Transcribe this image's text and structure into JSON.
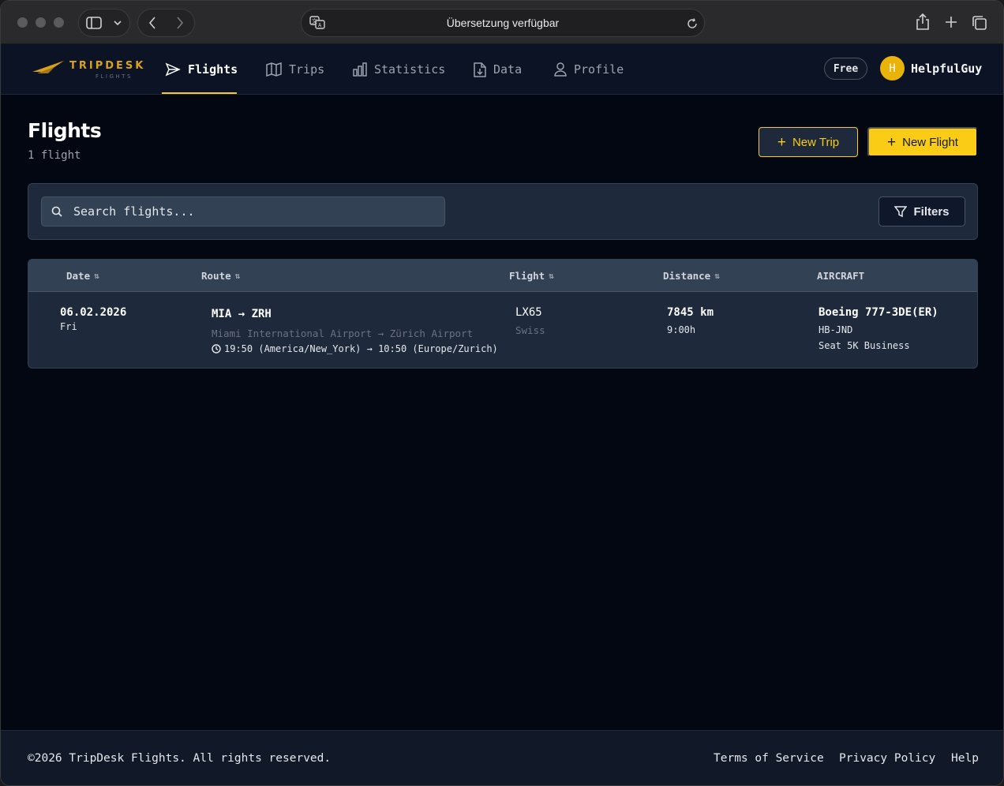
{
  "browser": {
    "address_text": "Übersetzung verfügbar"
  },
  "brand": {
    "name": "TRIPDESK",
    "sub": "FLIGHTS",
    "accent": "#facc15"
  },
  "nav": {
    "items": [
      {
        "label": "Flights",
        "icon": "send-icon",
        "active": true
      },
      {
        "label": "Trips",
        "icon": "map-icon",
        "active": false
      },
      {
        "label": "Statistics",
        "icon": "bar-chart-icon",
        "active": false
      },
      {
        "label": "Data",
        "icon": "file-import-icon",
        "active": false
      },
      {
        "label": "Profile",
        "icon": "user-icon",
        "active": false
      }
    ],
    "plan_badge": "Free",
    "avatar_initial": "H",
    "username": "HelpfulGuy"
  },
  "page": {
    "title": "Flights",
    "count": "1 flight",
    "new_trip_label": "New Trip",
    "new_flight_label": "New Flight"
  },
  "search": {
    "placeholder": "Search flights...",
    "filters_label": "Filters"
  },
  "table": {
    "columns": {
      "date": "Date",
      "route": "Route",
      "flight": "Flight",
      "distance": "Distance",
      "aircraft": "AIRCRAFT"
    },
    "rows": [
      {
        "date": "06.02.2026",
        "weekday": "Fri",
        "route": "MIA → ZRH",
        "airports": "Miami International Airport → Zürich Airport",
        "times": "19:50 (America/New_York) → 10:50 (Europe/Zurich)",
        "flight_no": "LX65",
        "airline": "Swiss",
        "distance": "7845 km",
        "duration": "9:00h",
        "aircraft": "Boeing 777-3DE(ER)",
        "registration": "HB-JND",
        "seat": "Seat 5K Business"
      }
    ]
  },
  "footer": {
    "copyright": "©2026 TripDesk Flights. All rights reserved.",
    "links": [
      "Terms of Service",
      "Privacy Policy",
      "Help"
    ]
  }
}
